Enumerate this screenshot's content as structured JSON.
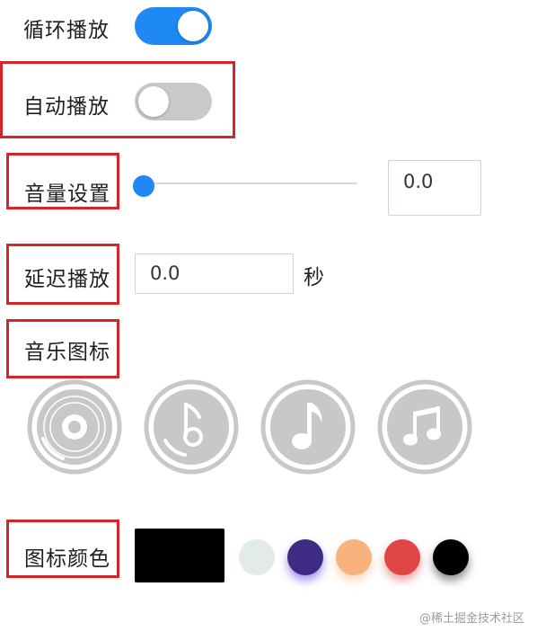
{
  "loop_play": {
    "label": "循环播放",
    "enabled": true
  },
  "auto_play": {
    "label": "自动播放",
    "enabled": false
  },
  "volume": {
    "label": "音量设置",
    "value": "0.0",
    "level": 0.0
  },
  "delay": {
    "label": "延迟播放",
    "value": "0.0",
    "unit": "秒"
  },
  "music_icons": {
    "label": "音乐图标",
    "icons": [
      "vinyl-record-icon",
      "music-note-disc-icon",
      "eighth-note-icon",
      "beamed-notes-icon"
    ],
    "icon_color": "#c8c8c8"
  },
  "icon_color": {
    "label": "图标颜色",
    "selected": "#000000",
    "swatches": [
      "#e3ebe7",
      "#3d2b84",
      "#f7b27d",
      "#e04646",
      "#000000"
    ]
  },
  "watermark": "@稀土掘金技术社区",
  "colors": {
    "accent": "#1e88f5",
    "highlight_border": "#d4252a",
    "toggle_off": "#c9c9cb"
  }
}
